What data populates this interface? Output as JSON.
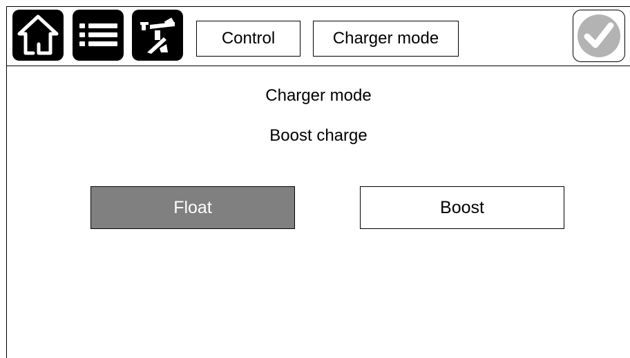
{
  "toolbar": {
    "home_icon": "home-icon",
    "menu_icon": "menu-list-icon",
    "tools_icon": "tools-icon",
    "breadcrumbs": [
      "Control",
      "Charger mode"
    ],
    "confirm_icon": "checkmark-icon"
  },
  "main": {
    "title": "Charger mode",
    "current_value": "Boost charge",
    "options": [
      {
        "label": "Float",
        "selected": true
      },
      {
        "label": "Boost",
        "selected": false
      }
    ]
  },
  "colors": {
    "selected_button": "#808080",
    "confirm_icon": "#b3b3b3"
  }
}
